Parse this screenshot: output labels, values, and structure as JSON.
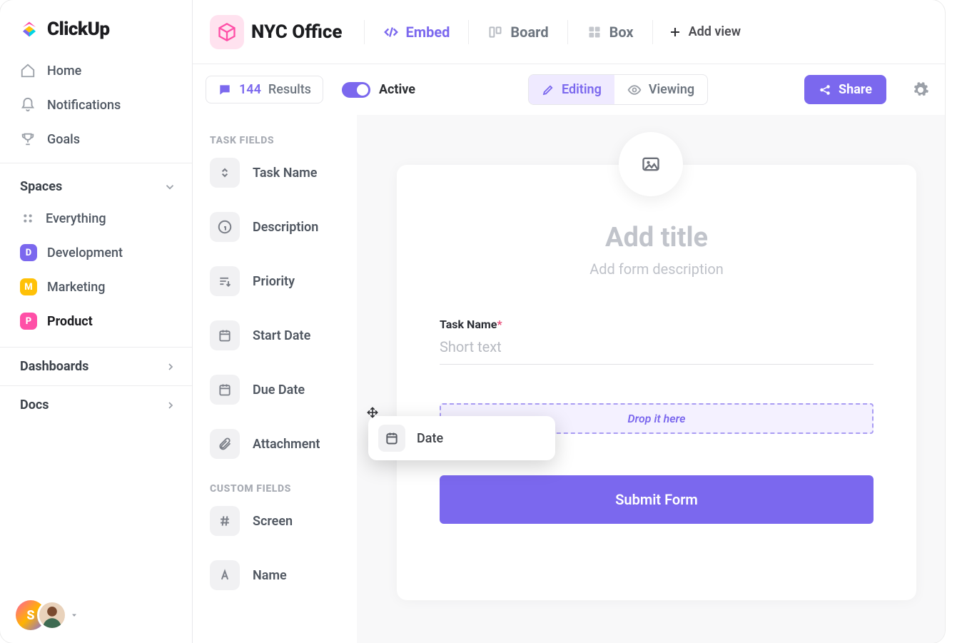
{
  "brand": {
    "name": "ClickUp"
  },
  "nav": {
    "home": "Home",
    "notifications": "Notifications",
    "goals": "Goals"
  },
  "spaces": {
    "heading": "Spaces",
    "everything": "Everything",
    "items": [
      {
        "letter": "D",
        "label": "Development",
        "color": "#7b68ee"
      },
      {
        "letter": "M",
        "label": "Marketing",
        "color": "#ffc107"
      },
      {
        "letter": "P",
        "label": "Product",
        "color": "#ff4fa7"
      }
    ],
    "active_index": 2
  },
  "rows": {
    "dashboards": "Dashboards",
    "docs": "Docs"
  },
  "user": {
    "initial": "S"
  },
  "header": {
    "title": "NYC Office",
    "views": [
      {
        "id": "embed",
        "label": "Embed"
      },
      {
        "id": "board",
        "label": "Board"
      },
      {
        "id": "box",
        "label": "Box"
      }
    ],
    "active_view": "embed",
    "add_view": "Add view"
  },
  "toolbar": {
    "results_count": "144",
    "results_word": "Results",
    "active_label": "Active",
    "editing": "Editing",
    "viewing": "Viewing",
    "share": "Share"
  },
  "panel": {
    "task_fields_heading": "TASK FIELDS",
    "task_fields": [
      {
        "id": "taskname",
        "label": "Task Name"
      },
      {
        "id": "description",
        "label": "Description"
      },
      {
        "id": "priority",
        "label": "Priority"
      },
      {
        "id": "startdate",
        "label": "Start Date"
      },
      {
        "id": "duedate",
        "label": "Due Date"
      },
      {
        "id": "attachment",
        "label": "Attachment"
      }
    ],
    "custom_fields_heading": "CUSTOM FIELDS",
    "custom_fields": [
      {
        "id": "screen",
        "label": "Screen"
      },
      {
        "id": "name",
        "label": "Name"
      }
    ]
  },
  "form": {
    "title_placeholder": "Add title",
    "desc_placeholder": "Add form description",
    "field_label": "Task Name",
    "field_required": "*",
    "field_placeholder": "Short text",
    "drop_text": "Drop it here",
    "submit": "Submit Form"
  },
  "drag_chip": {
    "label": "Date"
  }
}
